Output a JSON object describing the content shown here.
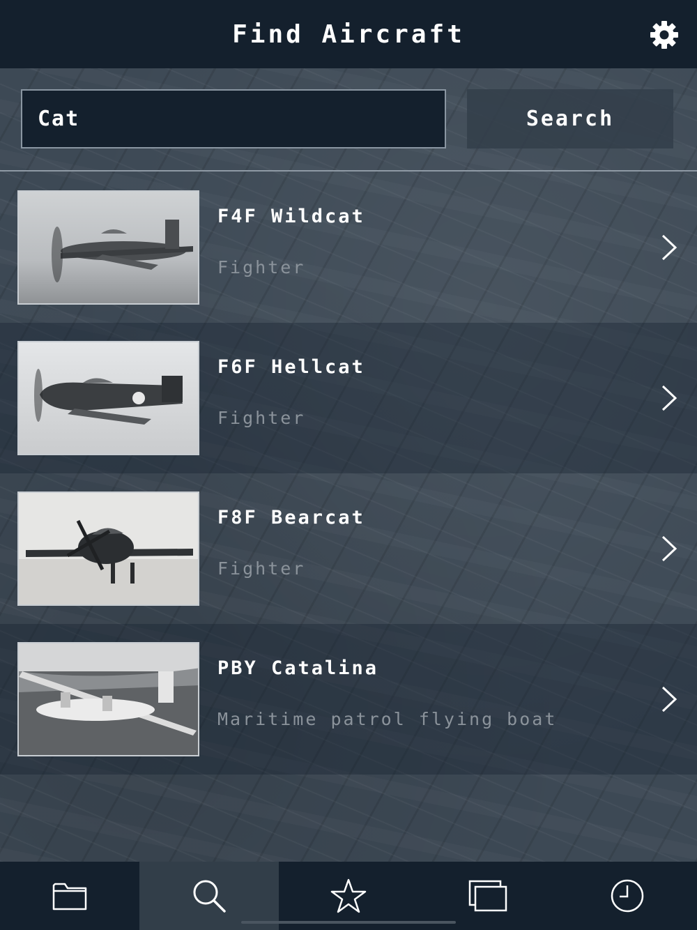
{
  "header": {
    "title": "Find Aircraft",
    "settings_icon": "gear-icon"
  },
  "search": {
    "value": "Cat",
    "button_label": "Search"
  },
  "results": [
    {
      "name": "F4F Wildcat",
      "role": "Fighter",
      "thumbnail_icon": "aircraft-photo",
      "chevron_icon": "chevron-right-icon"
    },
    {
      "name": "F6F Hellcat",
      "role": "Fighter",
      "thumbnail_icon": "aircraft-photo",
      "chevron_icon": "chevron-right-icon"
    },
    {
      "name": "F8F Bearcat",
      "role": "Fighter",
      "thumbnail_icon": "aircraft-photo",
      "chevron_icon": "chevron-right-icon"
    },
    {
      "name": "PBY Catalina",
      "role": "Maritime patrol flying boat",
      "thumbnail_icon": "aircraft-photo",
      "chevron_icon": "chevron-right-icon"
    }
  ],
  "tabbar": {
    "tabs": [
      {
        "icon": "folder-icon",
        "active": false
      },
      {
        "icon": "search-icon",
        "active": true
      },
      {
        "icon": "star-icon",
        "active": false
      },
      {
        "icon": "windows-icon",
        "active": false
      },
      {
        "icon": "clock-icon",
        "active": false
      }
    ]
  },
  "colors": {
    "bar_background": "#14202d",
    "active_tab": "#323e49",
    "subtitle_text": "#8b939b",
    "accent_text": "#ffffff"
  }
}
